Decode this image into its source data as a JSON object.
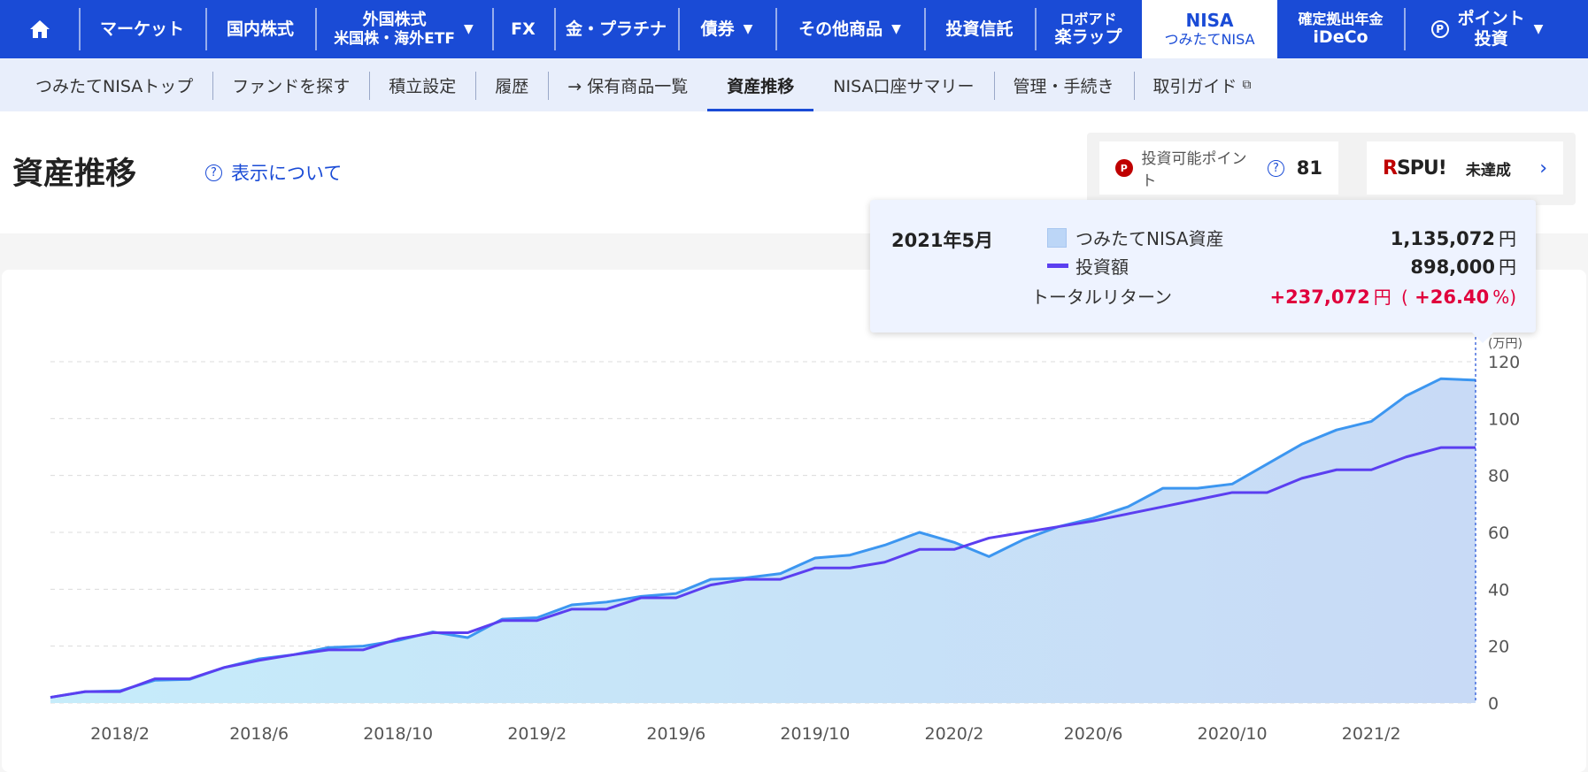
{
  "topnav": {
    "home_icon": "home-icon",
    "market": "マーケット",
    "domestic": "国内株式",
    "foreign_l1": "外国株式",
    "foreign_l2": "米国株・海外ETF",
    "fx": "FX",
    "gold": "金・プラチナ",
    "bonds": "債券",
    "others": "その他商品",
    "trust": "投資信託",
    "robo_l1": "ロボアド",
    "robo_l2": "楽ラップ",
    "nisa_l1": "NISA",
    "nisa_l2": "つみたてNISA",
    "ideco_l1": "確定拠出年金",
    "ideco_l2": "iDeCo",
    "point_l1": "ポイント",
    "point_l2": "投資",
    "caret": "▼"
  },
  "subnav": {
    "items": [
      "つみたてNISAトップ",
      "ファンドを探す",
      "積立設定",
      "履歴",
      "→ 保有商品一覧",
      "資産推移",
      "NISA口座サマリー",
      "管理・手続き",
      "取引ガイド"
    ],
    "active_index": 5
  },
  "header": {
    "title": "資産推移",
    "about_link": "表示について",
    "points_label": "投資可能ポイント",
    "points_value": "81",
    "spu_logo_r": "R",
    "spu_logo_rest": "SPU!",
    "spu_status": "未達成"
  },
  "tooltip": {
    "date": "2021年5月",
    "asset_label": "つみたてNISA資産",
    "asset_value": "1,135,072",
    "invest_label": "投資額",
    "invest_value": "898,000",
    "return_label": "トータルリターン",
    "return_value": "+237,072",
    "return_pct": "+26.40",
    "yen": "円",
    "pct_open": "(",
    "pct_close": "%)"
  },
  "colors": {
    "brand_blue": "#1a4bd6",
    "asset_line": "#3c96f0",
    "invest_line": "#5b3ff0",
    "return_red": "#e0003c"
  },
  "chart_data": {
    "type": "area",
    "yunit": "(万円)",
    "ylim": [
      0,
      120
    ],
    "yticks": [
      0,
      20,
      40,
      60,
      80,
      100,
      120
    ],
    "xtick_labels": [
      "2018/2",
      "2018/6",
      "2018/10",
      "2019/2",
      "2019/6",
      "2019/10",
      "2020/2",
      "2020/6",
      "2020/10",
      "2021/2"
    ],
    "x": [
      "2017/12",
      "2018/1",
      "2018/2",
      "2018/3",
      "2018/4",
      "2018/5",
      "2018/6",
      "2018/7",
      "2018/8",
      "2018/9",
      "2018/10",
      "2018/11",
      "2018/12",
      "2019/1",
      "2019/2",
      "2019/3",
      "2019/4",
      "2019/5",
      "2019/6",
      "2019/7",
      "2019/8",
      "2019/9",
      "2019/10",
      "2019/11",
      "2019/12",
      "2020/1",
      "2020/2",
      "2020/3",
      "2020/4",
      "2020/5",
      "2020/6",
      "2020/7",
      "2020/8",
      "2020/9",
      "2020/10",
      "2020/11",
      "2020/12",
      "2021/1",
      "2021/2",
      "2021/3",
      "2021/4",
      "2021/5"
    ],
    "series": [
      {
        "name": "つみたてNISA資産",
        "values": [
          2,
          4,
          4.3,
          8,
          8.3,
          12.5,
          15.5,
          17,
          19.5,
          20,
          22,
          25,
          23,
          29.5,
          30,
          34.5,
          35.5,
          37.5,
          38.5,
          43.5,
          44,
          45.5,
          51,
          52,
          55.5,
          60,
          56.5,
          51.5,
          57.5,
          62,
          65,
          69,
          75.5,
          75.5,
          77,
          84,
          91,
          96,
          99,
          108,
          114,
          113.5
        ]
      },
      {
        "name": "投資額",
        "values": [
          2,
          4,
          4,
          8.5,
          8.5,
          12.5,
          15,
          17,
          18.7,
          18.7,
          22.5,
          24.7,
          24.7,
          29,
          29,
          33,
          33,
          37,
          37,
          41.5,
          43.5,
          43.5,
          47.5,
          47.5,
          49.5,
          54,
          54,
          58,
          60,
          62,
          64,
          66.5,
          69,
          71.5,
          74,
          74,
          79,
          82,
          82,
          86.5,
          89.8,
          89.8
        ]
      }
    ]
  }
}
